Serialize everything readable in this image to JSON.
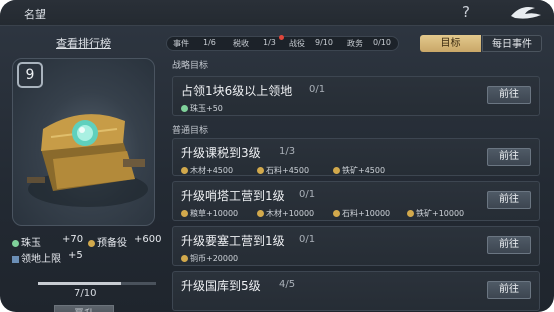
{
  "header": {
    "title": "名望",
    "help_icon": "?"
  },
  "left": {
    "view_rank": "查看排行榜",
    "level": "9",
    "stats": [
      {
        "icon": "jade-icon",
        "label": "珠玉",
        "value": "+70"
      },
      {
        "icon": "reserve-icon",
        "label": "预备役",
        "value": "+600"
      },
      {
        "icon": "territory-icon",
        "label": "领地上限",
        "value": "+5"
      }
    ],
    "progress": {
      "current": 7,
      "max": 10,
      "text": "7/10"
    },
    "upgrade_label": "晋升"
  },
  "statbar": [
    {
      "label": "事件",
      "value": "1/6"
    },
    {
      "label": "税收",
      "value": "1/3"
    },
    {
      "label": "战役",
      "value": "9/10"
    },
    {
      "label": "政务",
      "value": "0/10"
    }
  ],
  "tabs": {
    "active": "目标",
    "other": "每日事件"
  },
  "sections": {
    "strategic": "战略目标",
    "normal": "普通目标"
  },
  "strategic_goals": [
    {
      "name": "占领1块6级以上领地",
      "count": "0/1",
      "rewards": [
        "珠玉+50"
      ],
      "button": "前往"
    }
  ],
  "normal_goals": [
    {
      "name": "升级课税到3级",
      "count": "1/3",
      "rewards": [
        "木材+4500",
        "石料+4500",
        "铁矿+4500"
      ],
      "button": "前往"
    },
    {
      "name": "升级哨塔工营到1级",
      "count": "0/1",
      "rewards": [
        "粮草+10000",
        "木材+10000",
        "石料+10000",
        "铁矿+10000"
      ],
      "button": "前往"
    },
    {
      "name": "升级要塞工营到1级",
      "count": "0/1",
      "rewards": [
        "铜币+20000"
      ],
      "button": "前往"
    },
    {
      "name": "升级国库到5级",
      "count": "4/5",
      "rewards": [],
      "button": "前往"
    }
  ]
}
